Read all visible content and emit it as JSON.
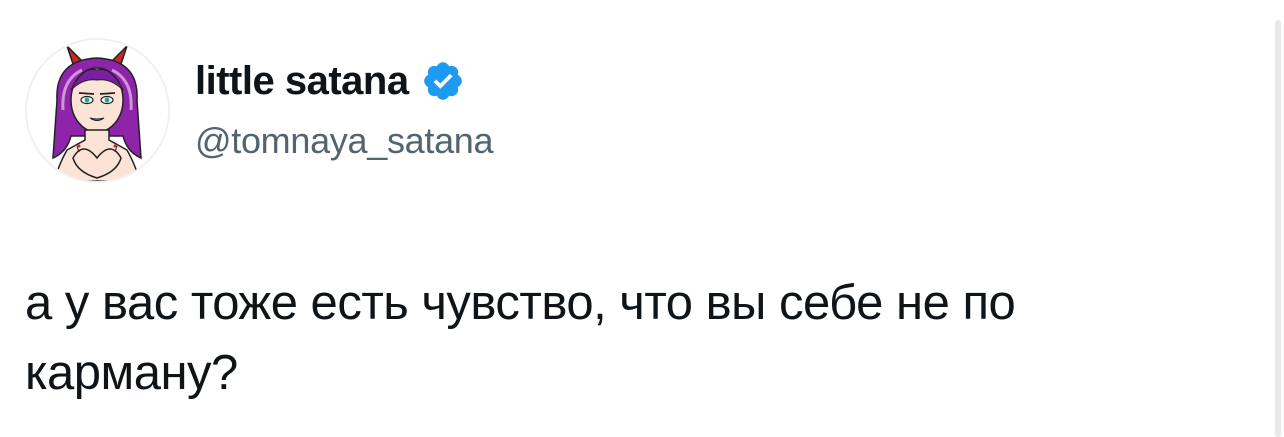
{
  "user": {
    "display_name": "little satana",
    "handle": "@tomnaya_satana",
    "verified": true,
    "verified_color": "#1d9bf0",
    "avatar_icon": "devil-girl-avatar"
  },
  "tweet": {
    "text": "а у вас тоже есть чувство, что вы себе не по карману?"
  },
  "colors": {
    "text_primary": "#0f1419",
    "text_secondary": "#536471"
  }
}
